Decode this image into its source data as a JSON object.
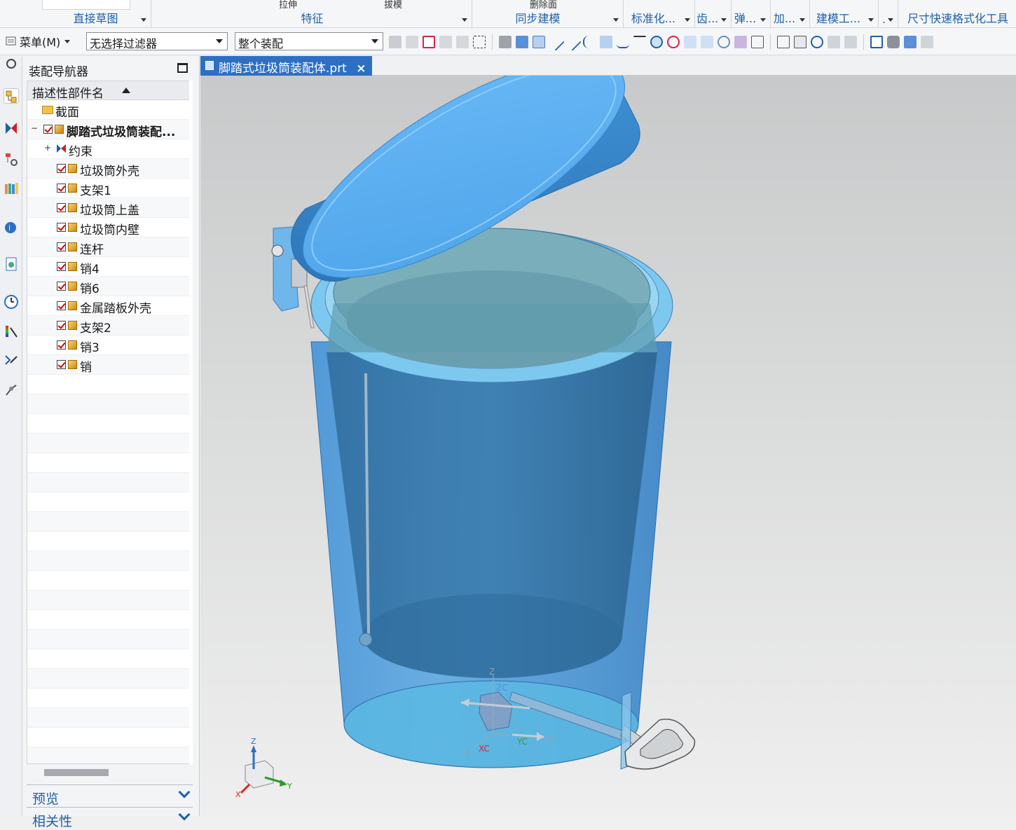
{
  "ribbon": {
    "groups": [
      {
        "label": "直接草图"
      },
      {
        "label": "特征",
        "top_items": [
          "拉伸",
          "拔模"
        ]
      },
      {
        "label": "同步建模",
        "top_items": [
          "删除面"
        ]
      },
      {
        "label": "标准化..."
      },
      {
        "label": "齿..."
      },
      {
        "label": "弹..."
      },
      {
        "label": "加..."
      },
      {
        "label": "建模工..."
      },
      {
        "label": "."
      },
      {
        "label": "尺寸快速格式化工具"
      }
    ]
  },
  "toolbar": {
    "menu_label": "菜单(M)",
    "selection_filter": "无选择过滤器",
    "selection_scope": "整个装配"
  },
  "navigator": {
    "title": "装配导航器",
    "column_header": "描述性部件名",
    "section_folder": "截面",
    "root_assembly": "脚踏式垃圾筒装配...",
    "constraints": "约束",
    "parts": [
      "垃圾筒外壳",
      "支架1",
      "垃圾筒上盖",
      "垃圾筒内壁",
      "连杆",
      "销4",
      "销6",
      "金属踏板外壳",
      "支架2",
      "销3",
      "销"
    ],
    "panels": [
      "预览",
      "相关性"
    ]
  },
  "graphics": {
    "tab_title": "脚踏式垃圾筒装配体.prt",
    "tab_close": "×",
    "axis_labels": {
      "z": "Z",
      "zc": "ZC",
      "xc": "XC",
      "yc": "YC",
      "y": "Y",
      "x": "X"
    },
    "triad_labels": {
      "z": "Z",
      "y": "Y",
      "x": "X"
    }
  },
  "colors": {
    "accent_blue": "#2d6fc3",
    "ribbon_label": "#1f5fa8",
    "model_blue": "#4a9fe0",
    "lid_blue": "#5aaef2"
  }
}
